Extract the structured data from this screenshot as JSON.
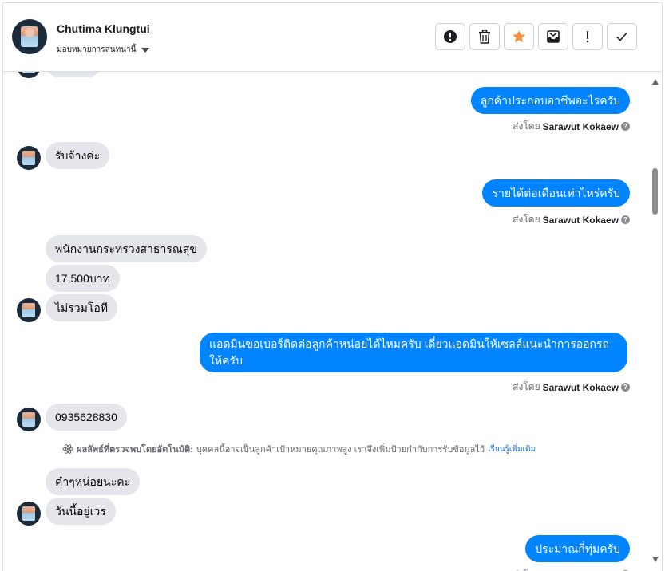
{
  "header": {
    "name": "Chutima Klungtui",
    "subtitle": "มอบหมายการสนทนานี้"
  },
  "toolbar": {
    "buttons": [
      {
        "icon": "alert-icon"
      },
      {
        "icon": "trash-icon"
      },
      {
        "icon": "star-icon",
        "color": "#f7923b"
      },
      {
        "icon": "mark-unread-icon"
      },
      {
        "icon": "exclamation-icon"
      },
      {
        "icon": "check-icon"
      }
    ]
  },
  "messages": {
    "m1": "ลูกค้าประกอบอาชีพอะไรครับ",
    "m2": "รับจ้างค่ะ",
    "m3": "รายได้ต่อเดือนเท่าไหร่ครับ",
    "m4": "พนักงานกระทรวงสาธารณสุข",
    "m5": "17,500บาท",
    "m6": "ไม่รวมโอที",
    "m7": "แอดมินขอเบอร์ติดต่อลูกค้าหน่อยได้ไหมครับ เดี๋ยวแอดมินให้เซลล์แนะนำการออกรถให้ครับ",
    "m8": "0935628830",
    "m9": "ค่ำๆหน่อยนะคะ",
    "m10": "วันนี้อยู่เวร",
    "m11": "ประมาณกี่ทุ่มครับ"
  },
  "sent_by": {
    "prefix": "ส่งโดย",
    "agent": "Sarawut Kokaew"
  },
  "auto_note": {
    "label": "ผลลัพธ์ที่ตรวจพบโดยอัตโนมัติ:",
    "text": "บุคคลนี้อาจเป็นลูกค้าเป้าหมายคุณภาพสูง เราจึงเพิ่มป้ายกำกับการรับข้อมูลไว้",
    "link": "เรียนรู้เพิ่มเติม"
  },
  "colors": {
    "outgoing_bubble": "#0084ff",
    "incoming_bubble": "#e4e6eb",
    "link": "#216fdb"
  }
}
